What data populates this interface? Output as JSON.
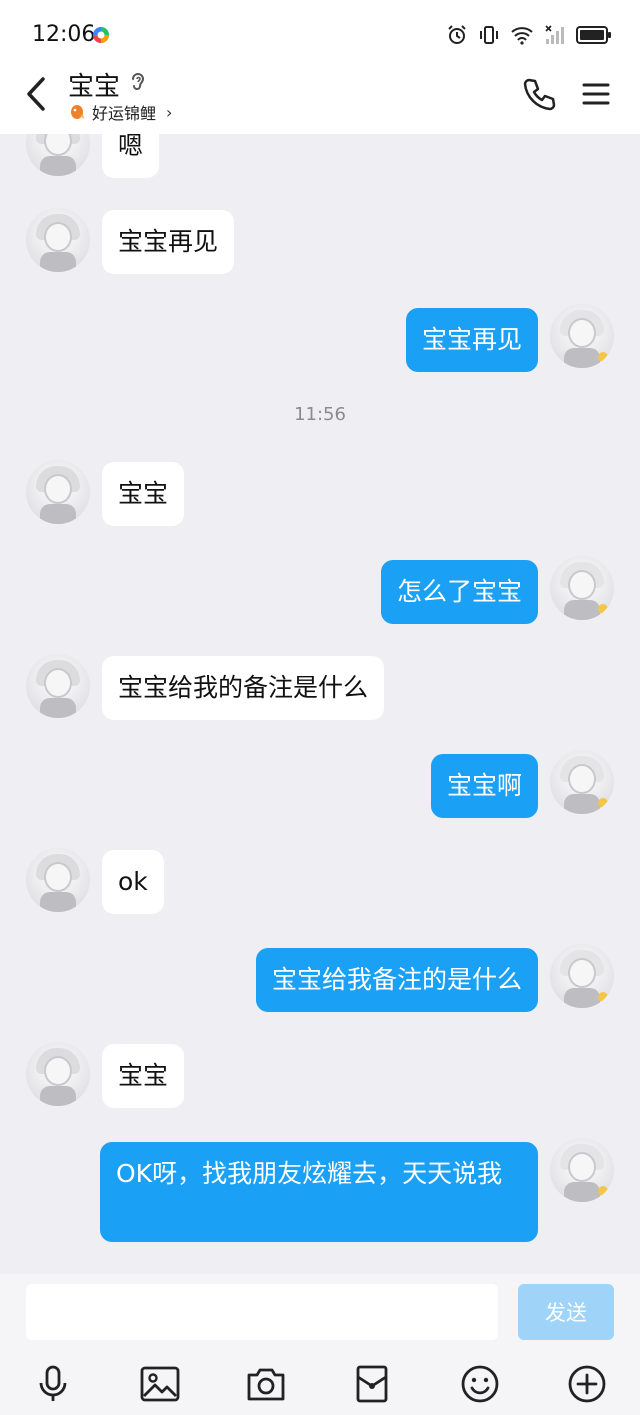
{
  "status_bar": {
    "time": "12:06"
  },
  "header": {
    "title": "宝宝",
    "subtitle": "好运锦鲤",
    "subtitle_chevron": "›"
  },
  "messages": [
    {
      "side": "left",
      "text": "嗯"
    },
    {
      "side": "left",
      "text": "宝宝再见"
    },
    {
      "side": "right",
      "text": "宝宝再见"
    },
    {
      "side": "time",
      "text": "11:56"
    },
    {
      "side": "left",
      "text": "宝宝"
    },
    {
      "side": "right",
      "text": "怎么了宝宝"
    },
    {
      "side": "left",
      "text": "宝宝给我的备注是什么"
    },
    {
      "side": "right",
      "text": "宝宝啊"
    },
    {
      "side": "left",
      "text": "ok"
    },
    {
      "side": "right",
      "text": "宝宝给我备注的是什么"
    },
    {
      "side": "left",
      "text": "宝宝"
    },
    {
      "side": "right",
      "text": "OK呀，找我朋友炫耀去，天天说我"
    }
  ],
  "input": {
    "value": "",
    "send_label": "发送"
  },
  "toolbar": [
    "mic-icon",
    "image-icon",
    "camera-icon",
    "red-packet-icon",
    "emoji-icon",
    "plus-icon"
  ],
  "colors": {
    "outgoing_bubble": "#1aa0f5",
    "incoming_bubble": "#ffffff",
    "background": "#eeeef3",
    "send_button": "#9fd3f7"
  }
}
